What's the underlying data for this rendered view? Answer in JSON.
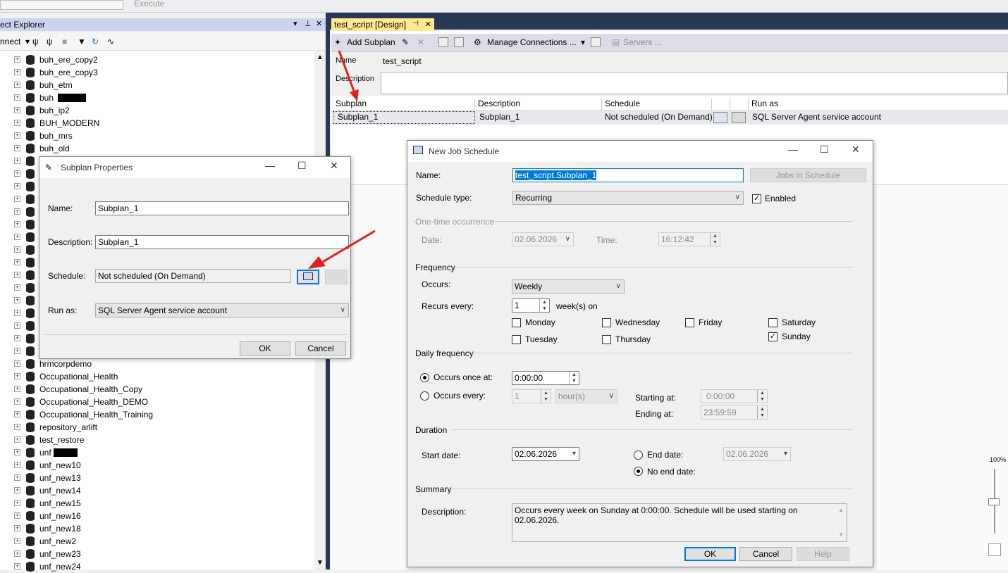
{
  "toolbar": {
    "execute_label": "Execute"
  },
  "object_explorer": {
    "title": "ect Explorer",
    "connect_label": "nnect",
    "nodes": [
      {
        "label": "buh_ere_copy2"
      },
      {
        "label": "buh_ere_copy3"
      },
      {
        "label": "buh_etm"
      },
      {
        "label": "buh"
      },
      {
        "label": "buh_ip2"
      },
      {
        "label": "BUH_MODERN"
      },
      {
        "label": "buh_mrs"
      },
      {
        "label": "buh_old"
      },
      {
        "label": "hrmcorpdemo"
      },
      {
        "label": "Occupational_Health"
      },
      {
        "label": "Occupational_Health_Copy"
      },
      {
        "label": "Occupational_Health_DEMO"
      },
      {
        "label": "Occupational_Health_Training"
      },
      {
        "label": "repository_arlift"
      },
      {
        "label": "test_restore"
      },
      {
        "label": "unf"
      },
      {
        "label": "unf_new10"
      },
      {
        "label": "unf_new13"
      },
      {
        "label": "unf_new14"
      },
      {
        "label": "unf_new15"
      },
      {
        "label": "unf_new16"
      },
      {
        "label": "unf_new18"
      },
      {
        "label": "unf_new2"
      },
      {
        "label": "unf_new23"
      },
      {
        "label": "unf_new24"
      }
    ]
  },
  "design": {
    "tab_label": "test_script [Design]",
    "add_subplan_label": "Add Subplan",
    "manage_connections_label": "Manage Connections ...",
    "servers_label": "Servers ...",
    "name_label": "Name",
    "name_value": "test_script",
    "description_label": "Description",
    "grid_headers": {
      "subplan": "Subplan",
      "description": "Description",
      "schedule": "Schedule",
      "run_as": "Run as"
    },
    "row": {
      "subplan": "Subplan_1",
      "description": "Subplan_1",
      "schedule": "Not scheduled (On Demand)",
      "run_as": "SQL Server Agent service account"
    },
    "zoom": "100%"
  },
  "subplan_dialog": {
    "title": "Subplan Properties",
    "name_label": "Name:",
    "name_value": "Subplan_1",
    "description_label": "Description:",
    "description_value": "Subplan_1",
    "schedule_label": "Schedule:",
    "schedule_value": "Not scheduled (On Demand)",
    "runas_label": "Run as:",
    "runas_value": "SQL Server Agent service account",
    "ok_label": "OK",
    "cancel_label": "Cancel"
  },
  "schedule_dialog": {
    "title": "New Job Schedule",
    "name_label": "Name:",
    "name_value": "test_script.Subplan_1",
    "jobs_button": "Jobs in Schedule",
    "type_label": "Schedule type:",
    "type_value": "Recurring",
    "enabled_label": "Enabled",
    "onetime_section": "One-time occurrence",
    "date_label": "Date:",
    "date_value": "02.06.2026",
    "time_label": "Time:",
    "time_value": "16:12:42",
    "frequency_section": "Frequency",
    "occurs_label": "Occurs:",
    "occurs_value": "Weekly",
    "recurs_label": "Recurs every:",
    "recurs_value": "1",
    "recurs_unit": "week(s) on",
    "days": {
      "monday": "Monday",
      "tuesday": "Tuesday",
      "wednesday": "Wednesday",
      "thursday": "Thursday",
      "friday": "Friday",
      "saturday": "Saturday",
      "sunday": "Sunday"
    },
    "daily_section": "Daily frequency",
    "once_label": "Occurs once at:",
    "once_value": "0:00:00",
    "every_label": "Occurs every:",
    "every_value": "1",
    "every_unit": "hour(s)",
    "starting_label": "Starting at:",
    "starting_value": "0:00:00",
    "ending_label": "Ending at:",
    "ending_value": "23:59:59",
    "duration_section": "Duration",
    "start_label": "Start date:",
    "start_value": "02.06.2026",
    "end_label": "End date:",
    "end_value": "02.06.2026",
    "noend_label": "No end date:",
    "summary_section": "Summary",
    "summary_label": "Description:",
    "summary_value": "Occurs every week on Sunday at 0:00:00. Schedule will be used starting on 02.06.2026.",
    "ok_label": "OK",
    "cancel_label": "Cancel",
    "help_label": "Help"
  },
  "colors": {
    "arrow": "#e02020",
    "dark_band": "#293955",
    "tab": "#ffe98f",
    "accent": "#0078d7"
  }
}
